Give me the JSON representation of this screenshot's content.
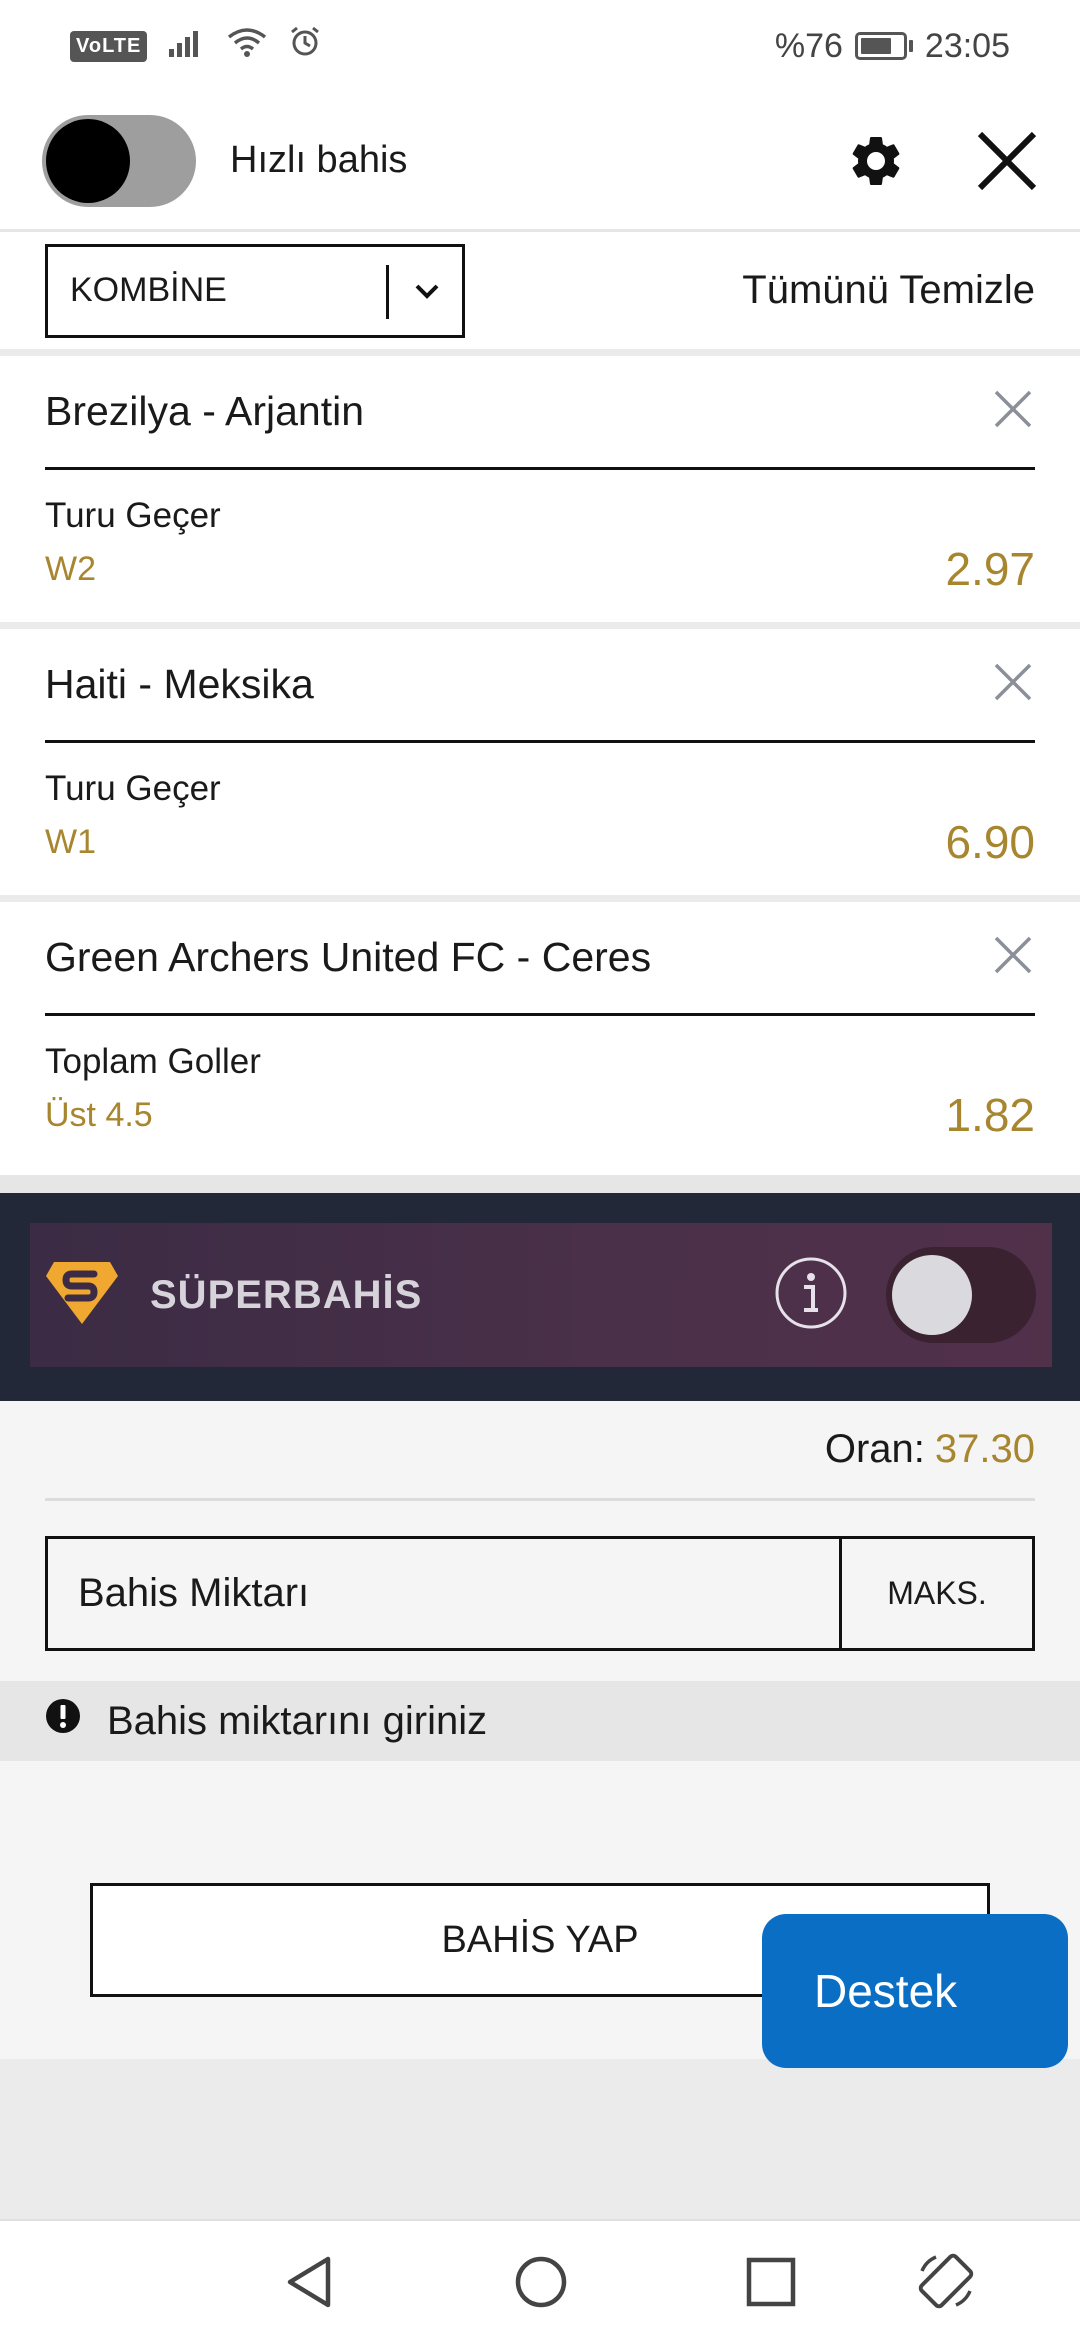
{
  "status_bar": {
    "volte": "VoLTE",
    "battery_text": "%76",
    "battery_level": 0.76,
    "time": "23:05"
  },
  "header": {
    "quick_bet_label": "Hızlı bahis",
    "quick_bet_on": false
  },
  "bet_type": {
    "selected": "KOMBİNE",
    "clear_all": "Tümünü Temizle"
  },
  "selections": [
    {
      "match": "Brezilya - Arjantin",
      "market": "Turu Geçer",
      "pick": "W2",
      "odd": "2.97"
    },
    {
      "match": "Haiti - Meksika",
      "market": "Turu Geçer",
      "pick": "W1",
      "odd": "6.90"
    },
    {
      "match": "Green Archers United FC - Ceres",
      "market": "Toplam Goller",
      "pick": "Üst 4.5",
      "odd": "1.82"
    }
  ],
  "superbahis": {
    "label": "SÜPERBAHİS",
    "enabled": false
  },
  "stake": {
    "odds_label": "Oran:",
    "odds_value": "37.30",
    "amount_placeholder": "Bahis Miktarı",
    "max_label": "MAKS.",
    "warning": "Bahis miktarını giriniz",
    "place_bet": "BAHİS YAP"
  },
  "support": {
    "label": "Destek"
  },
  "colors": {
    "accent_gold": "#a8862f",
    "support_blue": "#0a6fc4",
    "superbahis_bg": "#232838"
  }
}
